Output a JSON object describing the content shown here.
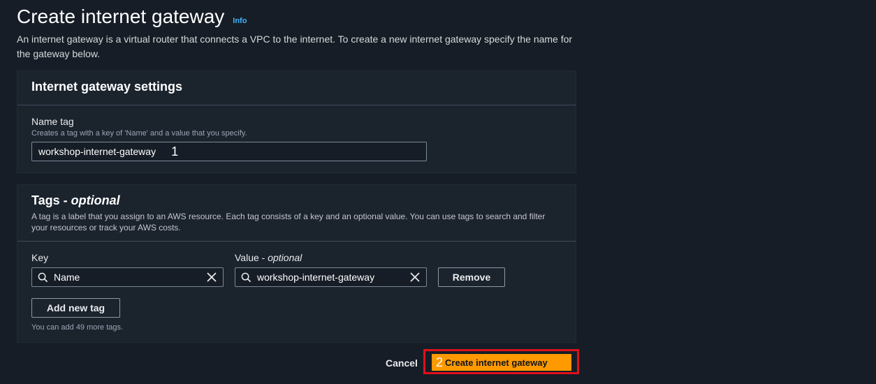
{
  "page": {
    "title": "Create internet gateway",
    "info_label": "Info",
    "description": "An internet gateway is a virtual router that connects a VPC to the internet. To create a new internet gateway specify the name for the gateway below."
  },
  "settings": {
    "title": "Internet gateway settings",
    "name_tag_label": "Name tag",
    "name_tag_desc": "Creates a tag with a key of 'Name' and a value that you specify.",
    "name_tag_value": "workshop-internet-gateway"
  },
  "tags": {
    "title_main": "Tags - ",
    "title_optional": "optional",
    "description": "A tag is a label that you assign to an AWS resource. Each tag consists of a key and an optional value. You can use tags to search and filter your resources or track your AWS costs.",
    "key_label": "Key",
    "value_label_main": "Value - ",
    "value_label_optional": "optional",
    "rows": [
      {
        "key": "Name",
        "value": "workshop-internet-gateway"
      }
    ],
    "remove_label": "Remove",
    "add_label": "Add new tag",
    "remaining_text": "You can add 49 more tags."
  },
  "footer": {
    "cancel_label": "Cancel",
    "create_label": "Create internet gateway"
  },
  "annotations": {
    "step1": "1",
    "step2": "2"
  },
  "colors": {
    "primary_button": "#ff9900",
    "highlight_border": "#e0101c",
    "info_link": "#42b4ff",
    "background": "#161d26"
  }
}
